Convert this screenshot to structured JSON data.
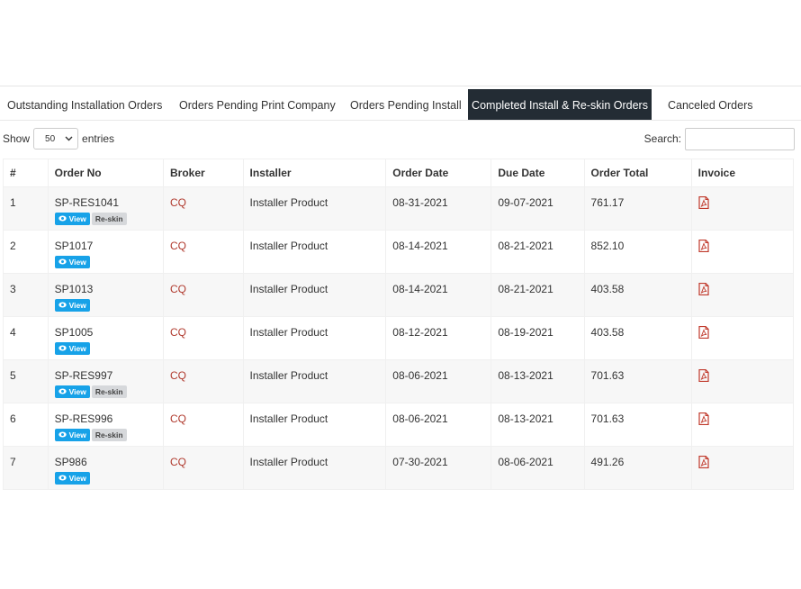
{
  "tabs": [
    {
      "label": "Outstanding Installation Orders",
      "active": false
    },
    {
      "label": "Orders Pending Print Company",
      "active": false
    },
    {
      "label": "Orders Pending Install",
      "active": false
    },
    {
      "label": "Completed Install & Re-skin Orders",
      "active": true
    },
    {
      "label": "Canceled Orders",
      "active": false
    }
  ],
  "controls": {
    "show_label": "Show",
    "entries_value": "50",
    "entries_label": "entries",
    "search_label": "Search:",
    "search_value": ""
  },
  "table": {
    "headers": [
      "#",
      "Order No",
      "Broker",
      "Installer",
      "Order Date",
      "Due Date",
      "Order Total",
      "Invoice"
    ],
    "view_label": "View",
    "reskin_label": "Re-skin",
    "rows": [
      {
        "num": "1",
        "order_no": "SP-RES1041",
        "reskin": true,
        "broker": "CQ",
        "installer": "Installer Product",
        "order_date": "08-31-2021",
        "due_date": "09-07-2021",
        "total": "761.17"
      },
      {
        "num": "2",
        "order_no": "SP1017",
        "reskin": false,
        "broker": "CQ",
        "installer": "Installer Product",
        "order_date": "08-14-2021",
        "due_date": "08-21-2021",
        "total": "852.10"
      },
      {
        "num": "3",
        "order_no": "SP1013",
        "reskin": false,
        "broker": "CQ",
        "installer": "Installer Product",
        "order_date": "08-14-2021",
        "due_date": "08-21-2021",
        "total": "403.58"
      },
      {
        "num": "4",
        "order_no": "SP1005",
        "reskin": false,
        "broker": "CQ",
        "installer": "Installer Product",
        "order_date": "08-12-2021",
        "due_date": "08-19-2021",
        "total": "403.58"
      },
      {
        "num": "5",
        "order_no": "SP-RES997",
        "reskin": true,
        "broker": "CQ",
        "installer": "Installer Product",
        "order_date": "08-06-2021",
        "due_date": "08-13-2021",
        "total": "701.63"
      },
      {
        "num": "6",
        "order_no": "SP-RES996",
        "reskin": true,
        "broker": "CQ",
        "installer": "Installer Product",
        "order_date": "08-06-2021",
        "due_date": "08-13-2021",
        "total": "701.63"
      },
      {
        "num": "7",
        "order_no": "SP986",
        "reskin": false,
        "broker": "CQ",
        "installer": "Installer Product",
        "order_date": "07-30-2021",
        "due_date": "08-06-2021",
        "total": "491.26"
      }
    ]
  },
  "icons": {
    "view": "eye-icon",
    "invoice": "pdf-file-icon",
    "select": "chevron-down-icon"
  },
  "colors": {
    "active_tab_bg": "#232c34",
    "view_badge": "#17a2e8",
    "reskin_badge": "#d6d8db",
    "broker_link": "#b03a2e",
    "pdf_icon": "#c0392b"
  }
}
